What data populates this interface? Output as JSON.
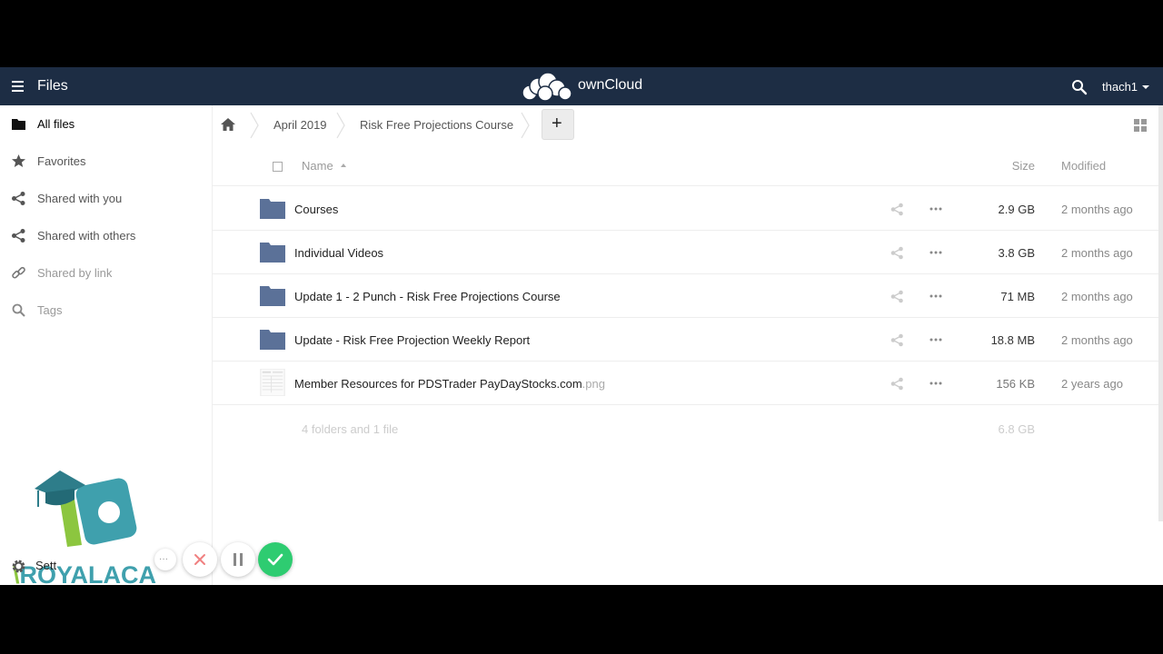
{
  "header": {
    "app_title": "Files",
    "brand": "ownCloud",
    "user": "thach1",
    "menu_icon": "hamburger-icon",
    "search_icon": "search-icon",
    "logo_icon": "cloud-logo-icon"
  },
  "sidebar": {
    "items": [
      {
        "label": "All files",
        "icon": "folder-icon"
      },
      {
        "label": "Favorites",
        "icon": "star-icon"
      },
      {
        "label": "Shared with you",
        "icon": "share-icon"
      },
      {
        "label": "Shared with others",
        "icon": "share-icon"
      },
      {
        "label": "Shared by link",
        "icon": "link-icon"
      },
      {
        "label": "Tags",
        "icon": "search-icon"
      }
    ],
    "settings_label": "Sett"
  },
  "breadcrumb": {
    "home_icon": "home-icon",
    "crumbs": [
      "April 2019",
      "Risk Free Projections Course"
    ],
    "new_label": "+"
  },
  "table": {
    "columns": {
      "name": "Name",
      "size": "Size",
      "modified": "Modified"
    },
    "rows": [
      {
        "name": "Courses",
        "ext": "",
        "type": "folder",
        "size": "2.9 GB",
        "modified": "2 months ago"
      },
      {
        "name": "Individual Videos",
        "ext": "",
        "type": "folder",
        "size": "3.8 GB",
        "modified": "2 months ago"
      },
      {
        "name": "Update 1 - 2 Punch - Risk Free Projections Course",
        "ext": "",
        "type": "folder",
        "size": "71 MB",
        "modified": "2 months ago"
      },
      {
        "name": "Update - Risk Free Projection Weekly Report",
        "ext": "",
        "type": "folder",
        "size": "18.8 MB",
        "modified": "2 months ago"
      },
      {
        "name": "Member Resources for PDSTrader PayDayStocks.com",
        "ext": ".png",
        "type": "image",
        "size": "156 KB",
        "modified": "2 years ago"
      }
    ],
    "summary": "4 folders and 1 file",
    "summary_size": "6.8 GB"
  },
  "watermark": {
    "first_letter": "\\",
    "text": "ROYALACA"
  },
  "controls": {
    "more_label": "···"
  },
  "colors": {
    "header_bg": "#1d2d44",
    "folder": "#5b7198",
    "confirm": "#2ecc71"
  }
}
